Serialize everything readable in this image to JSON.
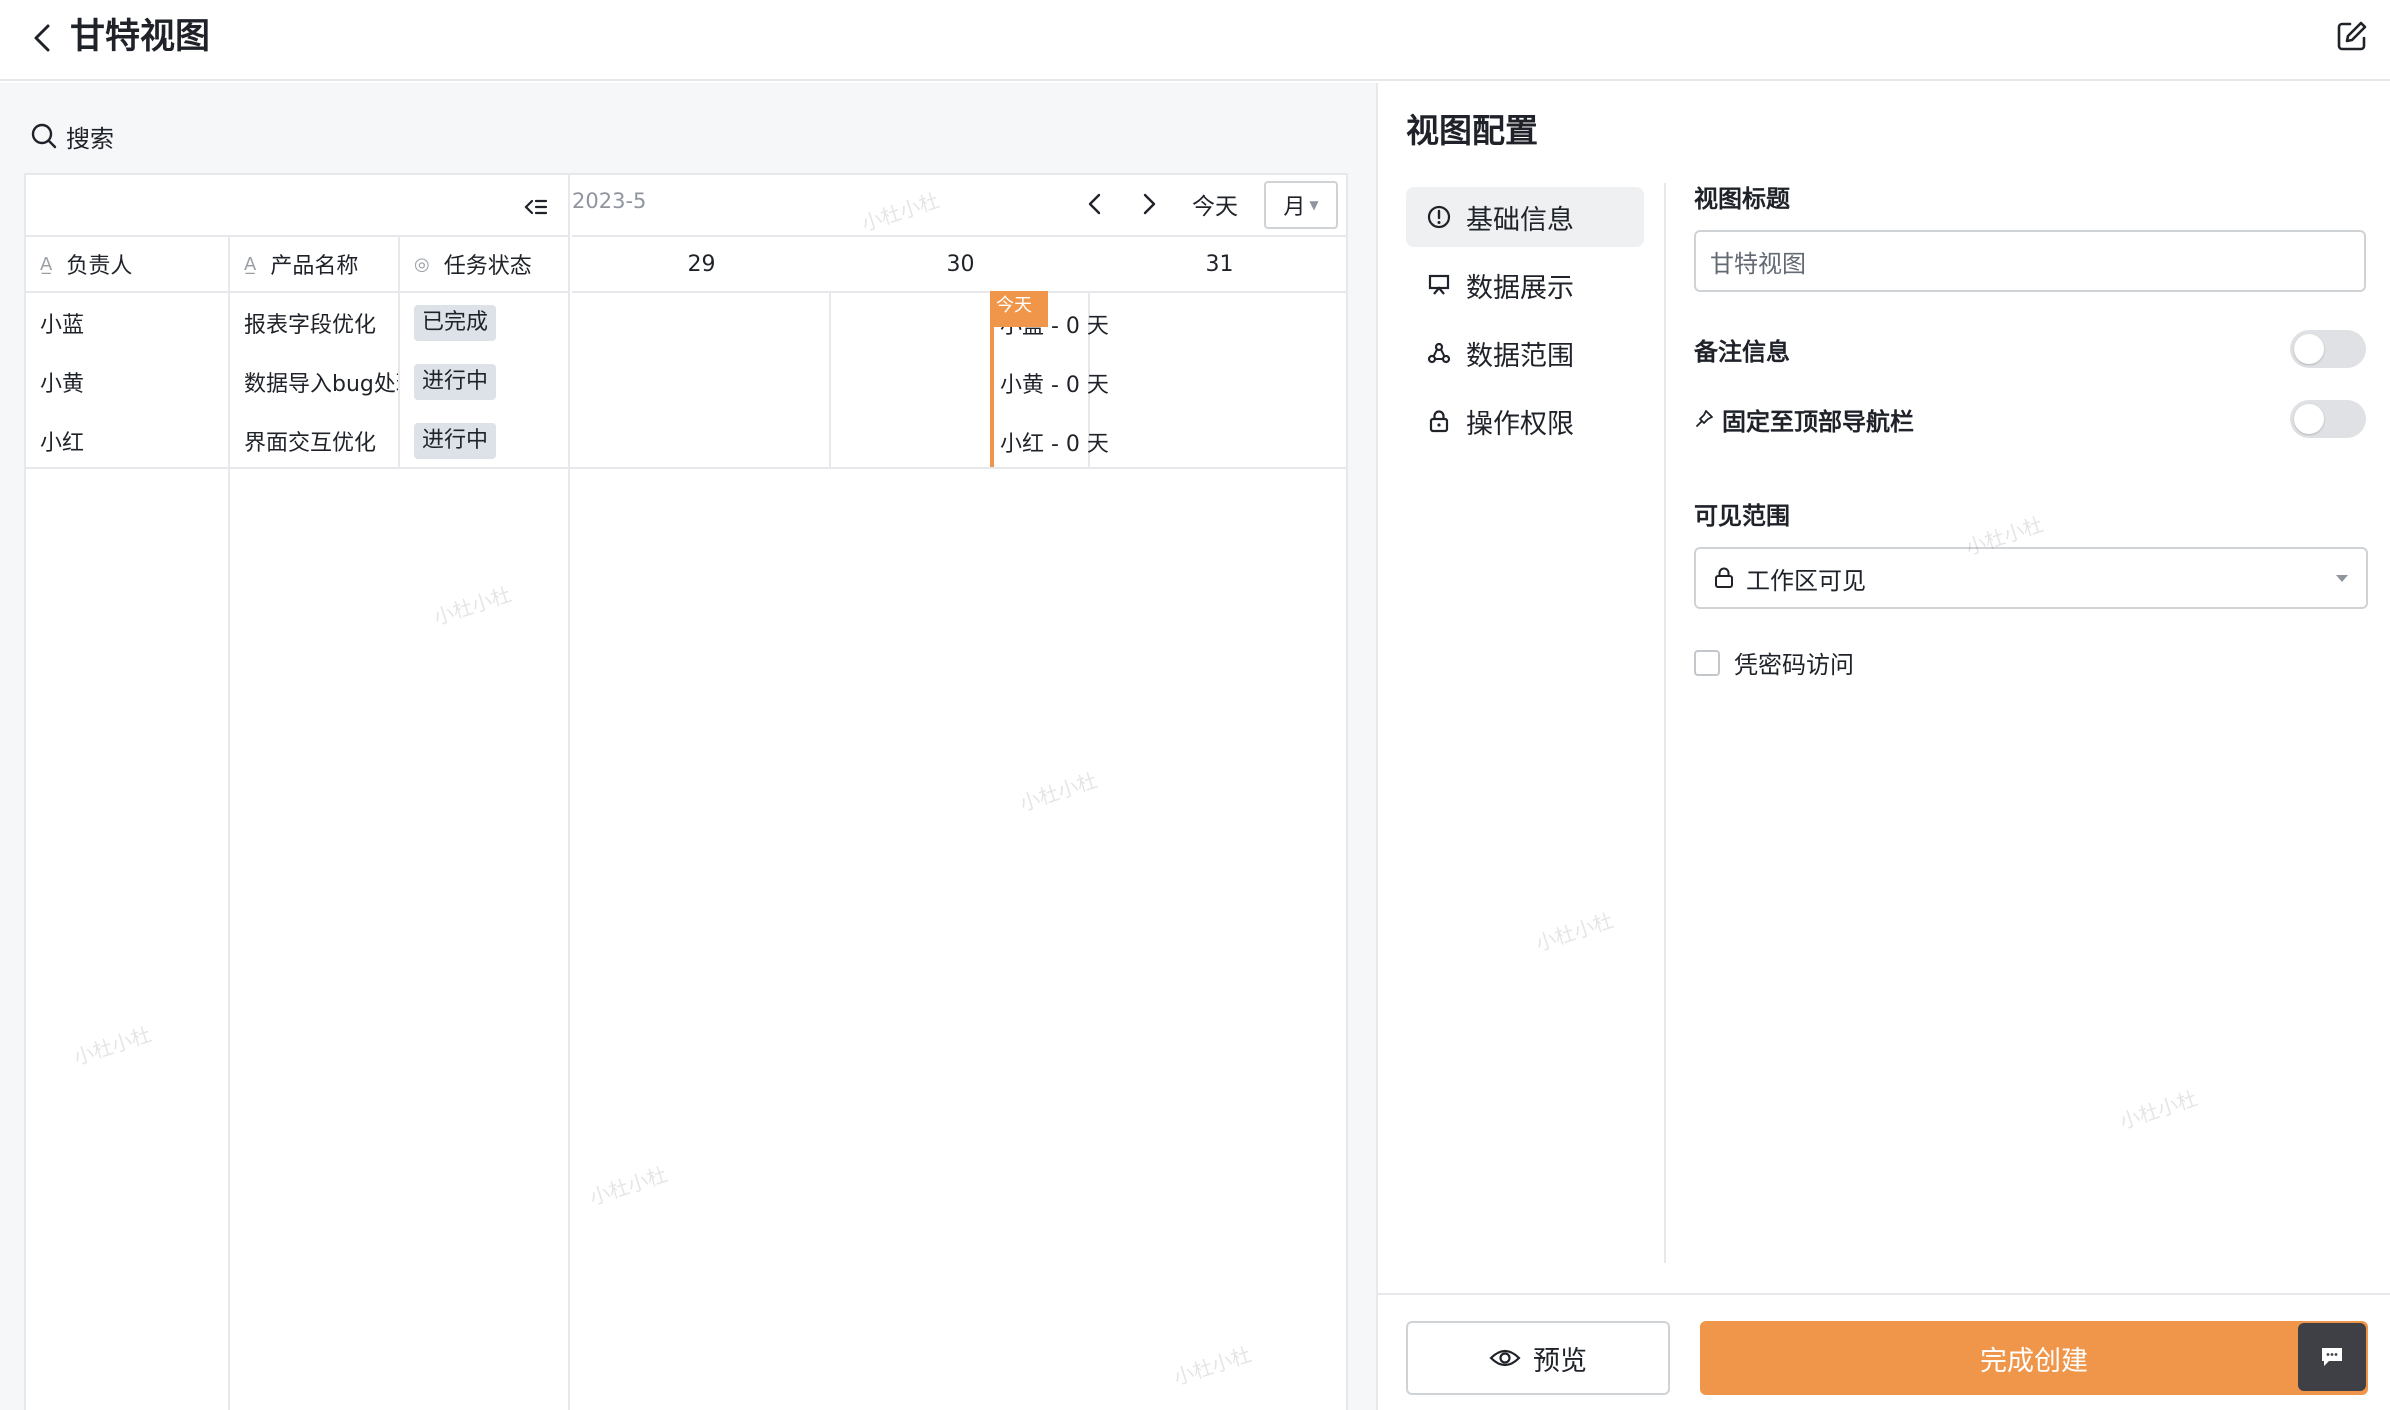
{
  "header": {
    "title": "甘特视图"
  },
  "search": {
    "label": "搜索"
  },
  "gantt": {
    "month": "2023-5",
    "today_label": "今天",
    "view_mode": "月",
    "columns": [
      "负责人",
      "产品名称",
      "任务状态"
    ],
    "days": [
      "29",
      "30",
      "31"
    ],
    "rows": [
      {
        "owner": "小蓝",
        "product": "报表字段优化",
        "status": "已完成",
        "bar": "小蓝 - 0 天"
      },
      {
        "owner": "小黄",
        "product": "数据导入bug处理",
        "status": "进行中",
        "bar": "小黄 - 0 天"
      },
      {
        "owner": "小红",
        "product": "界面交互优化",
        "status": "进行中",
        "bar": "小红 - 0 天"
      }
    ],
    "today_badge": "今天"
  },
  "panel": {
    "title": "视图配置",
    "menu": [
      "基础信息",
      "数据展示",
      "数据范围",
      "操作权限"
    ],
    "form": {
      "view_title_label": "视图标题",
      "view_title_value": "甘特视图",
      "notes_label": "备注信息",
      "pin_label": "固定至顶部导航栏",
      "visibility_label": "可见范围",
      "visibility_value": "工作区可见",
      "password_label": "凭密码访问"
    },
    "footer": {
      "preview": "预览",
      "create": "完成创建"
    }
  },
  "watermark": "小杜小杜",
  "colors": {
    "accent": "#f0964a",
    "tag_bg": "#dde1e8"
  }
}
